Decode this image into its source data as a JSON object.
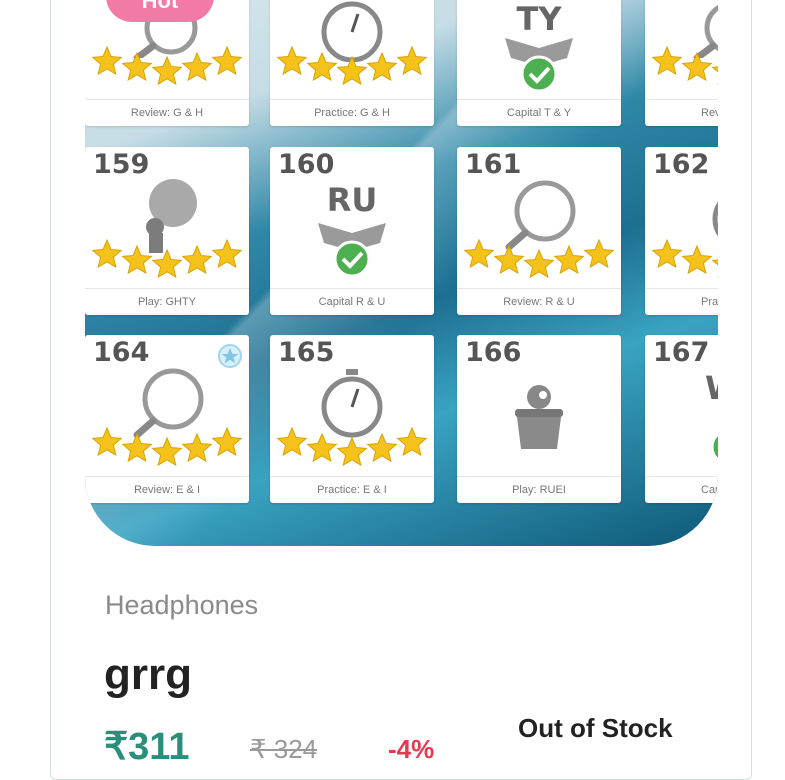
{
  "badge": {
    "label": "Hot"
  },
  "tiles_top": [
    {
      "label": "Review: G & H",
      "letters": "",
      "icon": "magnifier-icon"
    },
    {
      "label": "Practice: G & H",
      "letters": "",
      "icon": "stopwatch-icon"
    },
    {
      "label": "Capital T & Y",
      "letters": "TY",
      "icon": "box-check-icon"
    },
    {
      "label": "Revie",
      "letters": "",
      "icon": "magnifier-icon"
    }
  ],
  "tiles_mid": [
    {
      "num": "159",
      "label": "Play: GHTY",
      "letters": "",
      "icon": "balloon-monkey-icon"
    },
    {
      "num": "160",
      "label": "Capital R & U",
      "letters": "RU",
      "icon": "box-check-icon"
    },
    {
      "num": "161",
      "label": "Review: R & U",
      "letters": "",
      "icon": "magnifier-icon"
    },
    {
      "num": "162",
      "label": "Practi",
      "letters": "",
      "icon": "stopwatch-icon"
    }
  ],
  "tiles_bot": [
    {
      "num": "164",
      "label": "Review: E & I",
      "letters": "",
      "icon": "magnifier-icon"
    },
    {
      "num": "165",
      "label": "Practice: E & I",
      "letters": "",
      "icon": "stopwatch-icon"
    },
    {
      "num": "166",
      "label": "Play: RUEI",
      "letters": "",
      "icon": "bird-pot-icon"
    },
    {
      "num": "167",
      "label": "Capit",
      "letters": "W",
      "icon": "box-check-icon"
    }
  ],
  "product": {
    "category": "Headphones",
    "title": "grrg",
    "price": "₹311",
    "old_price": "₹ 324",
    "discount": "-4%",
    "stock": "Out of Stock"
  },
  "colors": {
    "accent_price": "#2a8f7a",
    "badge_pink": "#f37aa6",
    "discount_red": "#e8384f",
    "star_gold": "#f5c21b"
  }
}
